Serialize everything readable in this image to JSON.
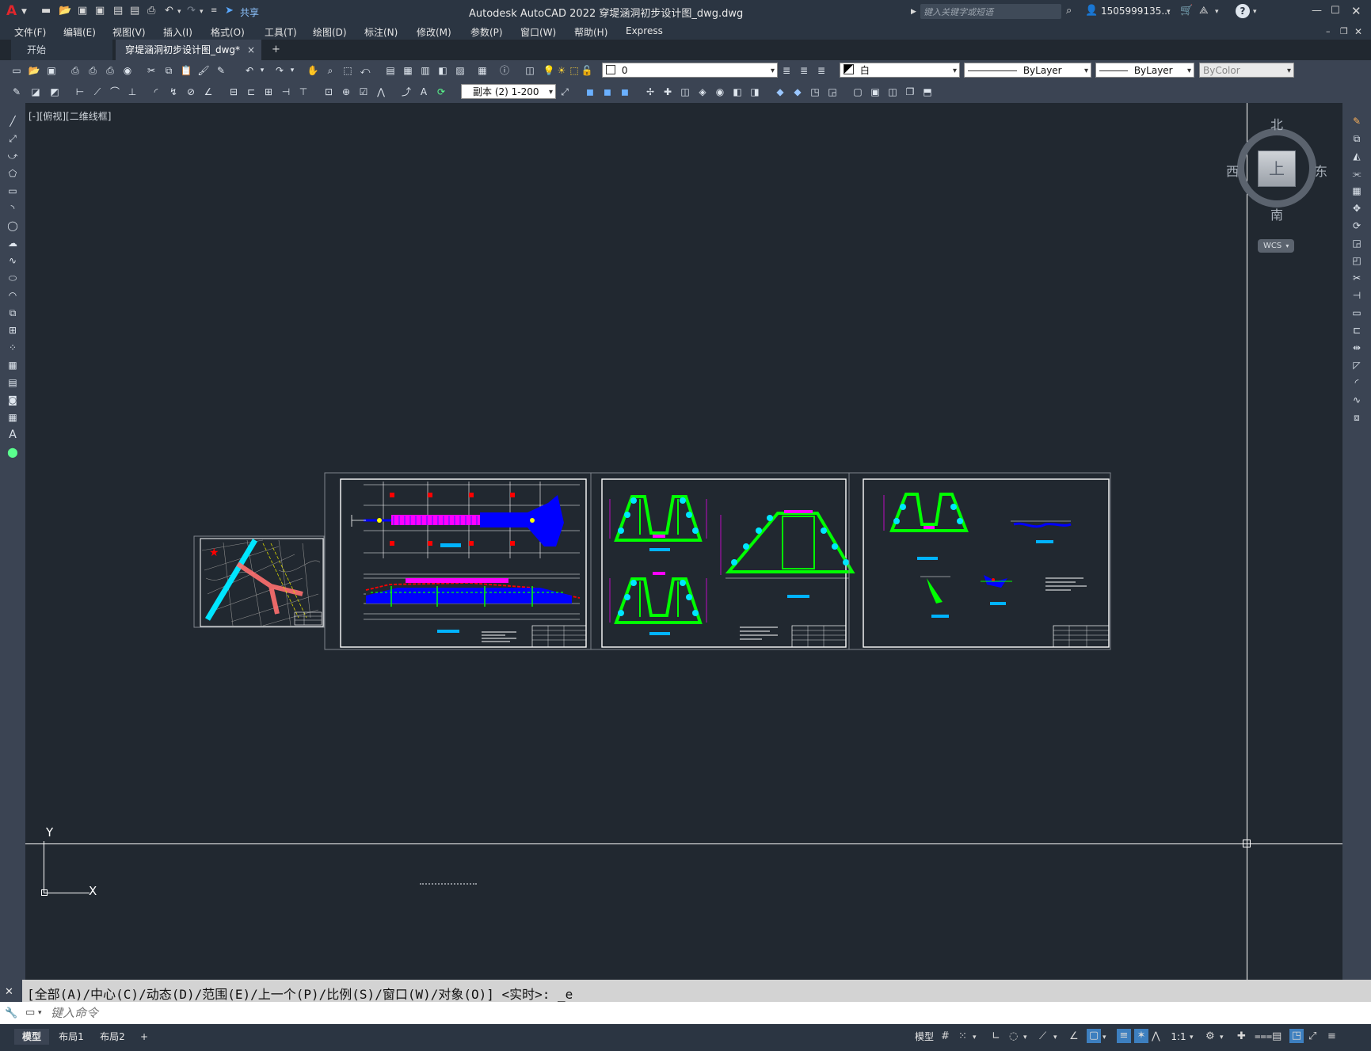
{
  "app": {
    "title": "Autodesk AutoCAD 2022    穿堤涵洞初步设计图_dwg.dwg",
    "logo": "A",
    "share_label": "共享",
    "search_placeholder": "键入关键字或短语",
    "user": "1505999135...",
    "help": "?"
  },
  "menu": [
    "文件(F)",
    "编辑(E)",
    "视图(V)",
    "插入(I)",
    "格式(O)",
    "工具(T)",
    "绘图(D)",
    "标注(N)",
    "修改(M)",
    "参数(P)",
    "窗口(W)",
    "帮助(H)",
    "Express"
  ],
  "tabs": {
    "start": "开始",
    "file": "穿堤涵洞初步设计图_dwg*",
    "close": "×",
    "add": "+"
  },
  "toolbar1": {
    "layer_value": "0",
    "color_value": "白",
    "linetype_value": "ByLayer",
    "lineweight_value": "ByLayer",
    "plotstyle_value": "ByColor"
  },
  "toolbar2": {
    "dimstyle_value": "副本 (2) 1-200"
  },
  "viewport": {
    "label": "[-][俯视][二维线框]",
    "viewcube": {
      "north": "北",
      "south": "南",
      "west": "西",
      "east": "东",
      "face": "上",
      "wcs": "WCS"
    },
    "ucs": {
      "x": "X",
      "y": "Y"
    }
  },
  "command": {
    "history": "[全部(A)/中心(C)/动态(D)/范围(E)/上一个(P)/比例(S)/窗口(W)/对象(O)] <实时>: _e",
    "placeholder": "键入命令"
  },
  "status": {
    "tabs": [
      "模型",
      "布局1",
      "布局2"
    ],
    "add": "+",
    "model_label": "模型",
    "scale": "1:1"
  },
  "colors": {
    "background": "#212830",
    "toolbar": "#3b4453",
    "titlebar": "#2b3542",
    "drawing_green": "#00ff00",
    "drawing_cyan": "#00e5ff",
    "drawing_blue": "#0000ff",
    "drawing_magenta": "#ff00ff",
    "drawing_red": "#ff0000",
    "drawing_white": "#ffffff"
  }
}
